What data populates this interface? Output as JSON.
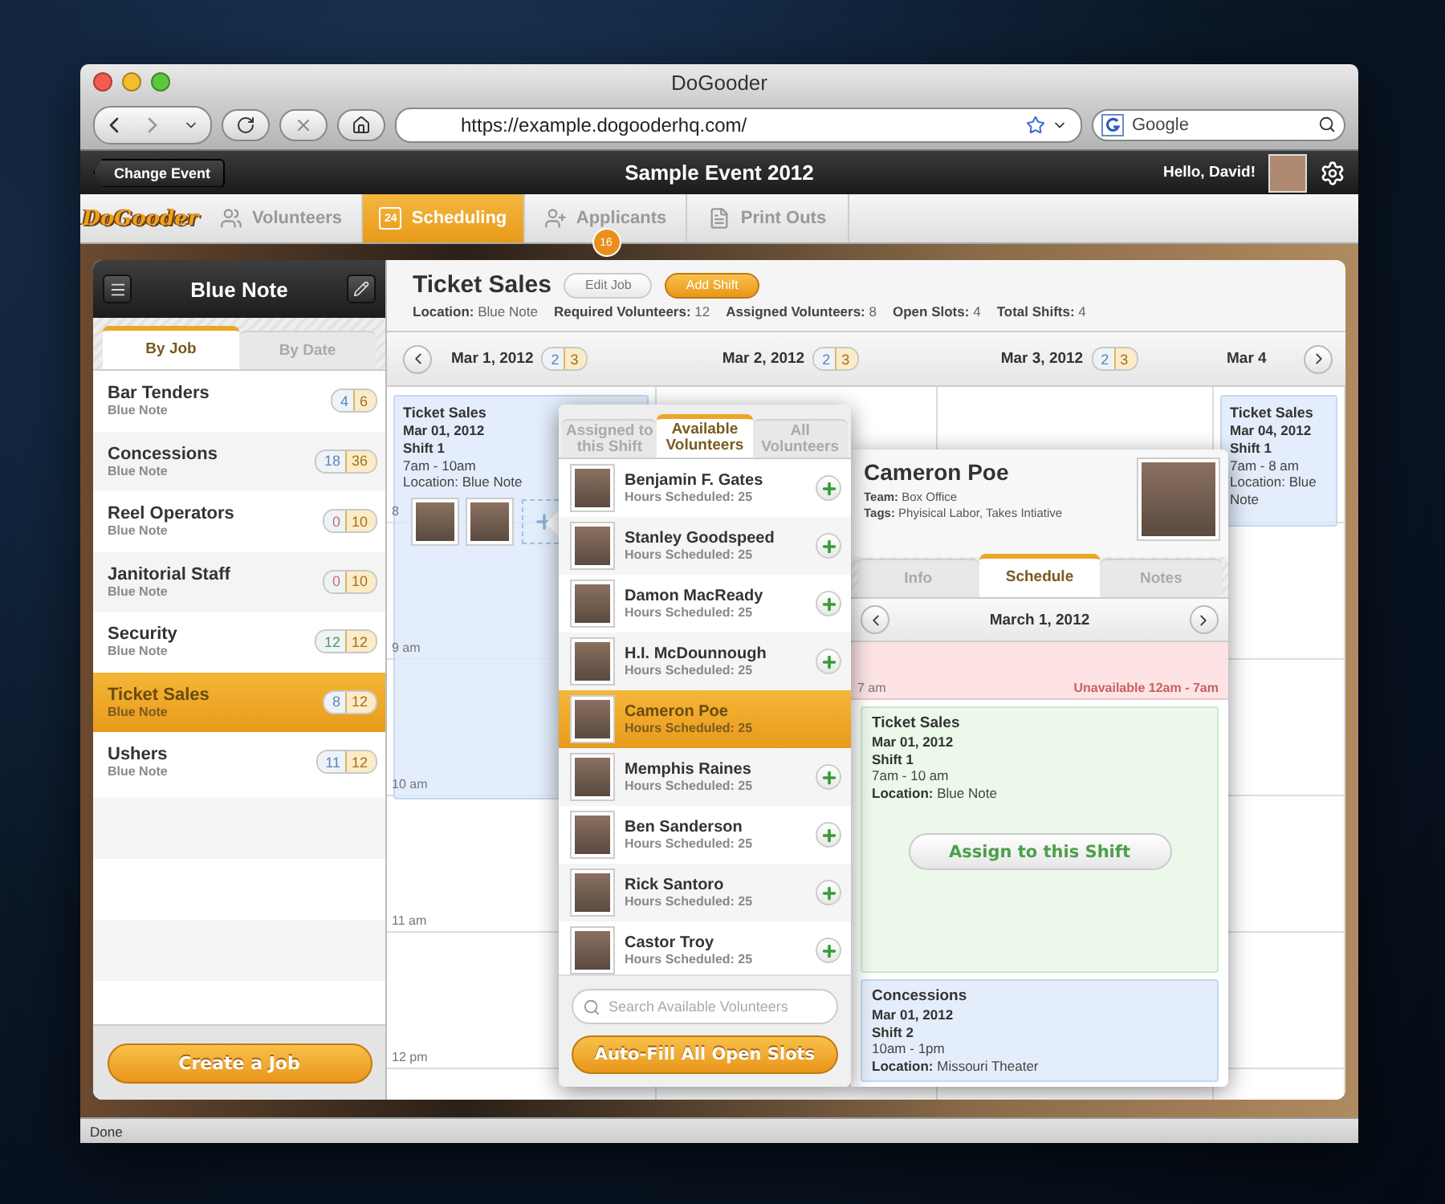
{
  "browser": {
    "title": "DoGooder",
    "url": "https://example.dogooderhq.com/",
    "search_placeholder": "Google"
  },
  "app_header": {
    "back_button": "Change Event",
    "event_title": "Sample Event 2012",
    "greeting": "Hello, David!"
  },
  "nav": {
    "logo": "DoGooder",
    "tabs": [
      {
        "label": "Volunteers",
        "selected": false
      },
      {
        "label": "Scheduling",
        "icon_text": "24",
        "selected": true
      },
      {
        "label": "Applicants",
        "badge": "16",
        "selected": false
      },
      {
        "label": "Print Outs",
        "selected": false
      }
    ]
  },
  "sidebar": {
    "title": "Blue Note",
    "tabs": [
      {
        "label": "By Job",
        "selected": true
      },
      {
        "label": "By Date",
        "selected": false
      }
    ],
    "jobs": [
      {
        "name": "Bar Tenders",
        "location": "Blue Note",
        "assigned": "4",
        "required": "6",
        "color": "#5b87bb",
        "selected": false
      },
      {
        "name": "Concessions",
        "location": "Blue Note",
        "assigned": "18",
        "required": "36",
        "color": "#5b87bb",
        "selected": false
      },
      {
        "name": "Reel Operators",
        "location": "Blue Note",
        "assigned": "0",
        "required": "10",
        "color": "#c86e6e",
        "selected": false
      },
      {
        "name": "Janitorial Staff",
        "location": "Blue Note",
        "assigned": "0",
        "required": "10",
        "color": "#c86e6e",
        "selected": false
      },
      {
        "name": "Security",
        "location": "Blue Note",
        "assigned": "12",
        "required": "12",
        "color": "#4f9b52",
        "selected": false
      },
      {
        "name": "Ticket Sales",
        "location": "Blue Note",
        "assigned": "8",
        "required": "12",
        "color": "#5b87bb",
        "selected": true
      },
      {
        "name": "Ushers",
        "location": "Blue Note",
        "assigned": "11",
        "required": "12",
        "color": "#5b87bb",
        "selected": false
      }
    ],
    "create_button": "Create a Job"
  },
  "job_header": {
    "title": "Ticket Sales",
    "buttons": [
      {
        "label": "Edit Job",
        "kind": "plain"
      },
      {
        "label": "Add Shift",
        "kind": "primary"
      }
    ],
    "stats": [
      {
        "label": "Location:",
        "value": "Blue Note"
      },
      {
        "label": "Required Volunteers:",
        "value": "12"
      },
      {
        "label": "Assigned Volunteers:",
        "value": "8"
      },
      {
        "label": "Open Slots:",
        "value": "4"
      },
      {
        "label": "Total Shifts:",
        "value": "4"
      }
    ]
  },
  "calendar": {
    "hour_labels": [
      "8",
      "9 am",
      "10 am",
      "11 am",
      "12 pm"
    ],
    "days": [
      {
        "label": "Mar 1, 2012",
        "assigned": "2",
        "required": "3",
        "shifts": [
          {
            "kind": "long",
            "title": "Ticket Sales",
            "date": "Mar 01, 2012",
            "shift": "Shift 1",
            "time": "7am - 10am",
            "location": "Location: Blue Note",
            "slots": [
              {
                "filled": true
              },
              {
                "filled": true
              },
              {
                "filled": false
              }
            ]
          }
        ]
      },
      {
        "label": "Mar 2, 2012",
        "assigned": "2",
        "required": "3"
      },
      {
        "label": "Mar 3, 2012",
        "assigned": "2",
        "required": "3"
      },
      {
        "label": "Mar 4",
        "shifts": [
          {
            "kind": "short",
            "title": "Ticket Sales",
            "date": "Mar 04, 2012",
            "shift": "Shift 1",
            "time": "7am - 8 am",
            "location": "Location: Blue Note"
          }
        ]
      }
    ]
  },
  "volunteer_picker": {
    "tabs": [
      {
        "label": "Assigned to this Shift",
        "selected": false
      },
      {
        "label": "Available Volunteers",
        "selected": true
      },
      {
        "label": "All Volunteers",
        "selected": false
      }
    ],
    "volunteers": [
      {
        "name": "Benjamin F. Gates",
        "hours": "Hours Scheduled: 25",
        "selected": false
      },
      {
        "name": "Stanley Goodspeed",
        "hours": "Hours Scheduled: 25",
        "selected": false
      },
      {
        "name": "Damon MacReady",
        "hours": "Hours Scheduled: 25",
        "selected": false
      },
      {
        "name": "H.I. McDounnough",
        "hours": "Hours Scheduled: 25",
        "selected": false
      },
      {
        "name": "Cameron Poe",
        "hours": "Hours Scheduled: 25",
        "selected": true
      },
      {
        "name": "Memphis Raines",
        "hours": "Hours Scheduled: 25",
        "selected": false
      },
      {
        "name": "Ben Sanderson",
        "hours": "Hours Scheduled: 25",
        "selected": false
      },
      {
        "name": "Rick Santoro",
        "hours": "Hours Scheduled: 25",
        "selected": false
      },
      {
        "name": "Castor Troy",
        "hours": "Hours Scheduled: 25",
        "selected": false
      }
    ],
    "search_placeholder": "Search Available Volunteers",
    "autofill_button": "Auto-Fill All Open Slots"
  },
  "volunteer_detail": {
    "name": "Cameron Poe",
    "team": "**Team:** Box Office",
    "tags": "**Tags:** Phyisical Labor, Takes Intiative",
    "tabs": [
      {
        "label": "Info",
        "selected": false
      },
      {
        "label": "Schedule",
        "selected": true
      },
      {
        "label": "Notes",
        "selected": false
      }
    ],
    "date": "March 1, 2012",
    "unavailable": {
      "hour_label": "7 am",
      "text": "Unavailable 12am - 7am"
    },
    "shifts": [
      {
        "kind": "current",
        "title": "Ticket Sales",
        "date": "Mar 01, 2012",
        "shift": "Shift 1",
        "time": "7am - 10 am",
        "location": "**Location:** Blue Note",
        "button": "Assign to this Shift"
      },
      {
        "kind": "other",
        "title": "Concessions",
        "date": "Mar 01, 2012",
        "shift": "Shift 2",
        "time": "10am - 1pm",
        "location": "**Location:** Missouri Theater"
      }
    ]
  },
  "status_bar": "Done"
}
